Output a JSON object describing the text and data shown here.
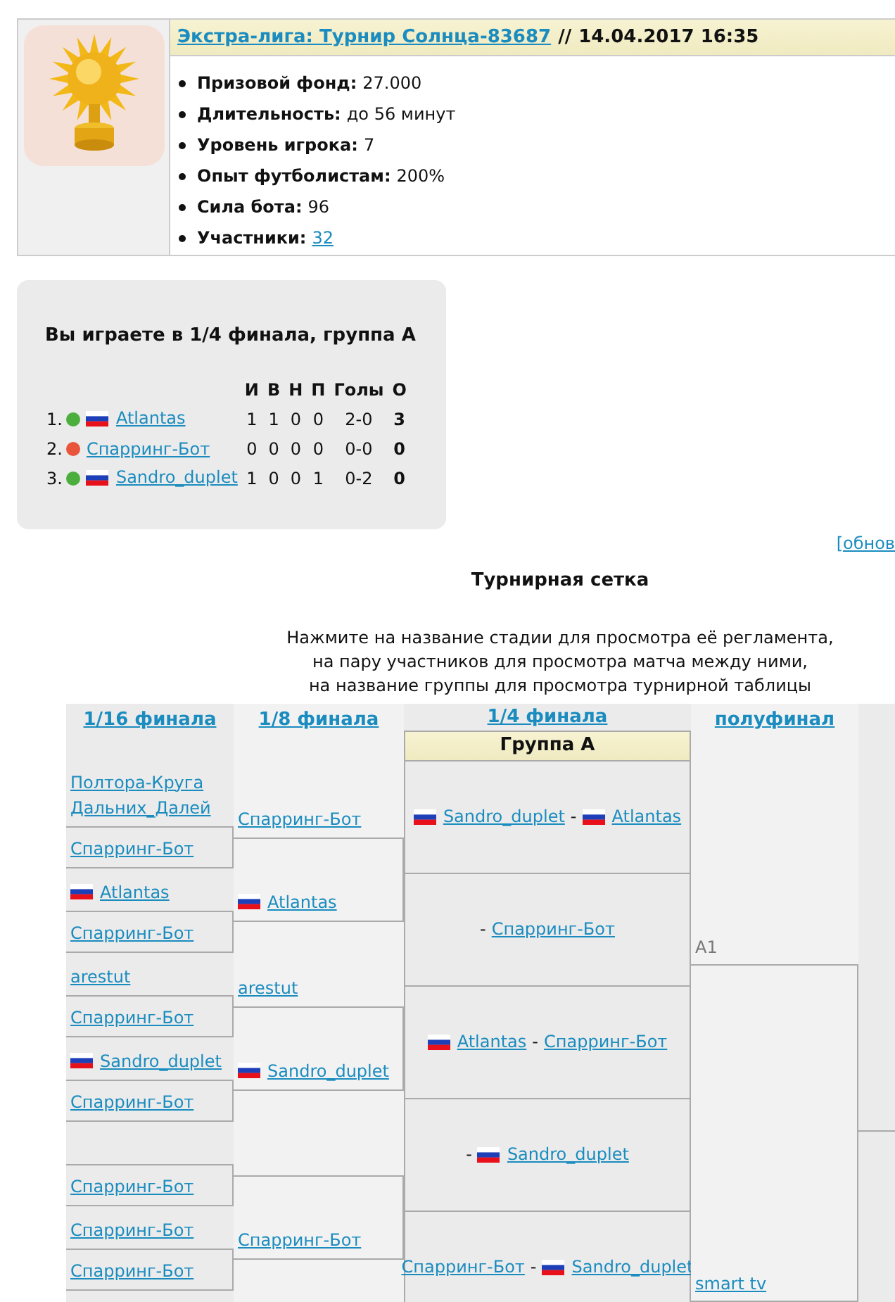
{
  "tournament": {
    "title": "Экстра-лига: Турнир Солнца-83687",
    "separator": "//",
    "datetime": "14.04.2017 16:35",
    "details": [
      {
        "label": "Призовой фонд:",
        "value": "27.000",
        "kind": "text"
      },
      {
        "label": "Длительность:",
        "value": "до 56 минут",
        "kind": "text"
      },
      {
        "label": "Уровень игрока:",
        "value": "7",
        "kind": "text"
      },
      {
        "label": "Опыт футболистам:",
        "value": "200%",
        "kind": "text"
      },
      {
        "label": "Сила бота:",
        "value": "96",
        "kind": "text"
      },
      {
        "label": "Участники:",
        "value": "32",
        "kind": "link"
      }
    ]
  },
  "group": {
    "title": "Вы играете в 1/4 финала, группа A",
    "columns": [
      "И",
      "В",
      "Н",
      "П",
      "Голы",
      "О"
    ],
    "rows": [
      {
        "place": "1.",
        "color": "#4cae3c",
        "flag": true,
        "name": "Atlantas",
        "cells": [
          "1",
          "1",
          "0",
          "0",
          "2-0",
          "3"
        ]
      },
      {
        "place": "2.",
        "color": "#e8553a",
        "flag": false,
        "name": "Спарринг-Бот",
        "cells": [
          "0",
          "0",
          "0",
          "0",
          "0-0",
          "0"
        ]
      },
      {
        "place": "3.",
        "color": "#4cae3c",
        "flag": true,
        "name": "Sandro_duplet",
        "cells": [
          "1",
          "0",
          "0",
          "1",
          "0-2",
          "0"
        ]
      }
    ]
  },
  "refresh_link": "[обнов",
  "bracket_title": "Турнирная сетка",
  "instructions": [
    "Нажмите на название стадии для просмотра её регламента,",
    "на пару участников для просмотра матча между ними,",
    "на название группы для просмотра турнирной таблицы"
  ],
  "bracket": {
    "stages": [
      "1/16 финала",
      "1/8 финала",
      "1/4 финала",
      "полуфинал"
    ],
    "round_of_32": [
      {
        "kind": "team",
        "name": "Полтора-Круга Дальних_Далей",
        "flag": false
      },
      {
        "kind": "team",
        "name": "Спарринг-Бот",
        "flag": false
      },
      {
        "kind": "team",
        "name": "Atlantas",
        "flag": true
      },
      {
        "kind": "team",
        "name": "Спарринг-Бот",
        "flag": false
      },
      {
        "kind": "team",
        "name": "arestut",
        "flag": false
      },
      {
        "kind": "team",
        "name": "Спарринг-Бот",
        "flag": false
      },
      {
        "kind": "team",
        "name": "Sandro_duplet",
        "flag": true
      },
      {
        "kind": "team",
        "name": "Спарринг-Бот",
        "flag": false
      },
      {
        "kind": "empty"
      },
      {
        "kind": "team",
        "name": "Спарринг-Бот",
        "flag": false
      },
      {
        "kind": "team",
        "name": "Спарринг-Бот",
        "flag": false
      },
      {
        "kind": "team",
        "name": "Спарринг-Бот",
        "flag": false
      }
    ],
    "round_of_16": [
      {
        "kind": "team",
        "name": "Спарринг-Бот",
        "flag": false
      },
      {
        "kind": "team",
        "name": "Atlantas",
        "flag": true
      },
      {
        "kind": "team",
        "name": "arestut",
        "flag": false
      },
      {
        "kind": "team",
        "name": "Sandro_duplet",
        "flag": true
      },
      {
        "kind": "empty"
      },
      {
        "kind": "team",
        "name": "Спарринг-Бот",
        "flag": false
      }
    ],
    "group_title": "Группа A",
    "matches": [
      {
        "separator": "-",
        "home": {
          "name": "Sandro_duplet",
          "flag": true
        },
        "away": {
          "name": "Atlantas",
          "flag": true
        }
      },
      {
        "separator": "-",
        "away": {
          "name": "Спарринг-Бот",
          "flag": false
        }
      },
      {
        "separator": "-",
        "home": {
          "name": "Atlantas",
          "flag": true
        },
        "away": {
          "name": "Спарринг-Бот",
          "flag": false
        }
      },
      {
        "separator": "-",
        "away": {
          "name": "Sandro_duplet",
          "flag": true
        }
      },
      {
        "separator": "-",
        "home": {
          "name": "Спарринг-Бот",
          "flag": false
        },
        "away": {
          "name": "Sandro_duplet",
          "flag": true
        }
      }
    ],
    "semifinal": [
      {
        "kind": "placeholder",
        "name": "A1"
      },
      {
        "kind": "team",
        "name": "smart tv"
      }
    ]
  }
}
